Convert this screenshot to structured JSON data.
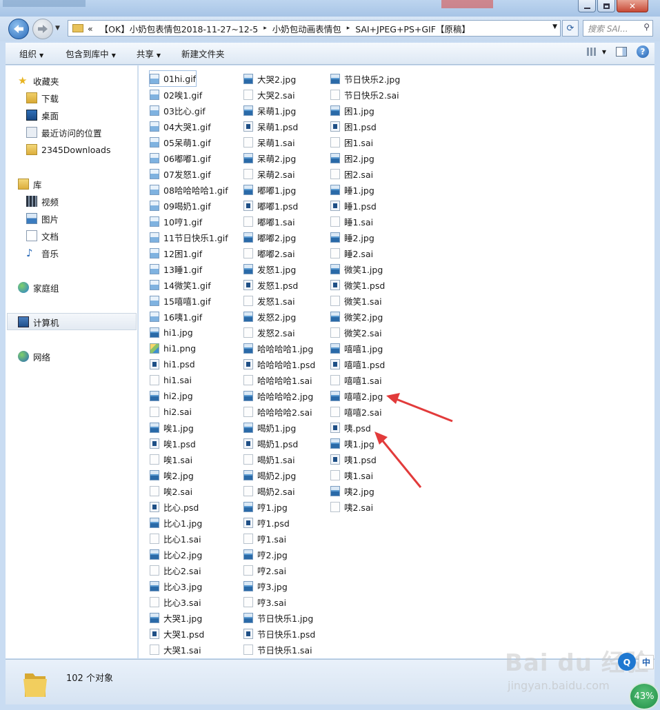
{
  "address": {
    "overflow": "«",
    "crumbs": [
      "【OK】小奶包表情包2018-11-27~12-5",
      "小奶包动画表情包",
      "SAI+JPEG+PS+GIF【原稿】"
    ],
    "sep": "▸"
  },
  "search": {
    "placeholder": "搜索 SAI..."
  },
  "toolbar": {
    "organize": "组织",
    "include": "包含到库中",
    "share": "共享",
    "new_folder": "新建文件夹"
  },
  "sidebar": {
    "favorites": "收藏夹",
    "fav_items": [
      "下载",
      "桌面",
      "最近访问的位置",
      "2345Downloads"
    ],
    "libraries": "库",
    "lib_items": [
      "视频",
      "图片",
      "文档",
      "音乐"
    ],
    "homegroup": "家庭组",
    "computer": "计算机",
    "network": "网络"
  },
  "files": {
    "col1": [
      {
        "name": "01hi.gif",
        "type": "gif"
      },
      {
        "name": "02唉1.gif",
        "type": "gif"
      },
      {
        "name": "03比心.gif",
        "type": "gif"
      },
      {
        "name": "04大哭1.gif",
        "type": "gif"
      },
      {
        "name": "05呆萌1.gif",
        "type": "gif"
      },
      {
        "name": "06嘟嘟1.gif",
        "type": "gif"
      },
      {
        "name": "07发怒1.gif",
        "type": "gif"
      },
      {
        "name": "08哈哈哈哈1.gif",
        "type": "gif"
      },
      {
        "name": "09喝奶1.gif",
        "type": "gif"
      },
      {
        "name": "10哼1.gif",
        "type": "gif"
      },
      {
        "name": "11节日快乐1.gif",
        "type": "gif"
      },
      {
        "name": "12困1.gif",
        "type": "gif"
      },
      {
        "name": "13睡1.gif",
        "type": "gif"
      },
      {
        "name": "14微笑1.gif",
        "type": "gif"
      },
      {
        "name": "15嘻嘻1.gif",
        "type": "gif"
      },
      {
        "name": "16咦1.gif",
        "type": "gif"
      },
      {
        "name": "hi1.jpg",
        "type": "img"
      },
      {
        "name": "hi1.png",
        "type": "png"
      },
      {
        "name": "hi1.psd",
        "type": "psd"
      },
      {
        "name": "hi1.sai",
        "type": "sai"
      },
      {
        "name": "hi2.jpg",
        "type": "img"
      },
      {
        "name": "hi2.sai",
        "type": "sai"
      },
      {
        "name": "唉1.jpg",
        "type": "img"
      },
      {
        "name": "唉1.psd",
        "type": "psd"
      },
      {
        "name": "唉1.sai",
        "type": "sai"
      },
      {
        "name": "唉2.jpg",
        "type": "img"
      },
      {
        "name": "唉2.sai",
        "type": "sai"
      },
      {
        "name": "比心.psd",
        "type": "psd"
      },
      {
        "name": "比心1.jpg",
        "type": "img"
      },
      {
        "name": "比心1.sai",
        "type": "sai"
      },
      {
        "name": "比心2.jpg",
        "type": "img"
      },
      {
        "name": "比心2.sai",
        "type": "sai"
      },
      {
        "name": "比心3.jpg",
        "type": "img"
      },
      {
        "name": "比心3.sai",
        "type": "sai"
      },
      {
        "name": "大哭1.jpg",
        "type": "img"
      },
      {
        "name": "大哭1.psd",
        "type": "psd"
      },
      {
        "name": "大哭1.sai",
        "type": "sai"
      }
    ],
    "col2": [
      {
        "name": "大哭2.jpg",
        "type": "img"
      },
      {
        "name": "大哭2.sai",
        "type": "sai"
      },
      {
        "name": "呆萌1.jpg",
        "type": "img"
      },
      {
        "name": "呆萌1.psd",
        "type": "psd"
      },
      {
        "name": "呆萌1.sai",
        "type": "sai"
      },
      {
        "name": "呆萌2.jpg",
        "type": "img"
      },
      {
        "name": "呆萌2.sai",
        "type": "sai"
      },
      {
        "name": "嘟嘟1.jpg",
        "type": "img"
      },
      {
        "name": "嘟嘟1.psd",
        "type": "psd"
      },
      {
        "name": "嘟嘟1.sai",
        "type": "sai"
      },
      {
        "name": "嘟嘟2.jpg",
        "type": "img"
      },
      {
        "name": "嘟嘟2.sai",
        "type": "sai"
      },
      {
        "name": "发怒1.jpg",
        "type": "img"
      },
      {
        "name": "发怒1.psd",
        "type": "psd"
      },
      {
        "name": "发怒1.sai",
        "type": "sai"
      },
      {
        "name": "发怒2.jpg",
        "type": "img"
      },
      {
        "name": "发怒2.sai",
        "type": "sai"
      },
      {
        "name": "哈哈哈哈1.jpg",
        "type": "img"
      },
      {
        "name": "哈哈哈哈1.psd",
        "type": "psd"
      },
      {
        "name": "哈哈哈哈1.sai",
        "type": "sai"
      },
      {
        "name": "哈哈哈哈2.jpg",
        "type": "img"
      },
      {
        "name": "哈哈哈哈2.sai",
        "type": "sai"
      },
      {
        "name": "喝奶1.jpg",
        "type": "img"
      },
      {
        "name": "喝奶1.psd",
        "type": "psd"
      },
      {
        "name": "喝奶1.sai",
        "type": "sai"
      },
      {
        "name": "喝奶2.jpg",
        "type": "img"
      },
      {
        "name": "喝奶2.sai",
        "type": "sai"
      },
      {
        "name": "哼1.jpg",
        "type": "img"
      },
      {
        "name": "哼1.psd",
        "type": "psd"
      },
      {
        "name": "哼1.sai",
        "type": "sai"
      },
      {
        "name": "哼2.jpg",
        "type": "img"
      },
      {
        "name": "哼2.sai",
        "type": "sai"
      },
      {
        "name": "哼3.jpg",
        "type": "img"
      },
      {
        "name": "哼3.sai",
        "type": "sai"
      },
      {
        "name": "节日快乐1.jpg",
        "type": "img"
      },
      {
        "name": "节日快乐1.psd",
        "type": "psd"
      },
      {
        "name": "节日快乐1.sai",
        "type": "sai"
      }
    ],
    "col3": [
      {
        "name": "节日快乐2.jpg",
        "type": "img"
      },
      {
        "name": "节日快乐2.sai",
        "type": "sai"
      },
      {
        "name": "困1.jpg",
        "type": "img"
      },
      {
        "name": "困1.psd",
        "type": "psd"
      },
      {
        "name": "困1.sai",
        "type": "sai"
      },
      {
        "name": "困2.jpg",
        "type": "img"
      },
      {
        "name": "困2.sai",
        "type": "sai"
      },
      {
        "name": "睡1.jpg",
        "type": "img"
      },
      {
        "name": "睡1.psd",
        "type": "psd"
      },
      {
        "name": "睡1.sai",
        "type": "sai"
      },
      {
        "name": "睡2.jpg",
        "type": "img"
      },
      {
        "name": "睡2.sai",
        "type": "sai"
      },
      {
        "name": "微笑1.jpg",
        "type": "img"
      },
      {
        "name": "微笑1.psd",
        "type": "psd"
      },
      {
        "name": "微笑1.sai",
        "type": "sai"
      },
      {
        "name": "微笑2.jpg",
        "type": "img"
      },
      {
        "name": "微笑2.sai",
        "type": "sai"
      },
      {
        "name": "嘻嘻1.jpg",
        "type": "img"
      },
      {
        "name": "嘻嘻1.psd",
        "type": "psd"
      },
      {
        "name": "嘻嘻1.sai",
        "type": "sai"
      },
      {
        "name": "嘻嘻2.jpg",
        "type": "img"
      },
      {
        "name": "嘻嘻2.sai",
        "type": "sai"
      },
      {
        "name": "咦.psd",
        "type": "psd"
      },
      {
        "name": "咦1.jpg",
        "type": "img"
      },
      {
        "name": "咦1.psd",
        "type": "psd"
      },
      {
        "name": "咦1.sai",
        "type": "sai"
      },
      {
        "name": "咦2.jpg",
        "type": "img"
      },
      {
        "name": "咦2.sai",
        "type": "sai"
      }
    ]
  },
  "status": {
    "count": "102 个对象"
  },
  "overlay": {
    "watermark": "Bai du 经验",
    "watermark_url": "jingyan.baidu.com",
    "ime_lang": "中",
    "ime_q": "Q",
    "battery": "43%"
  },
  "colors": {
    "arrow": "#e23b3b",
    "accent": "#1f5fb0"
  }
}
